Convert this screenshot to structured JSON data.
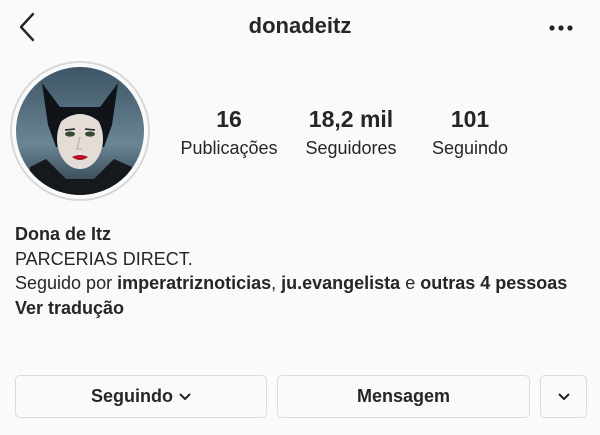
{
  "header": {
    "username": "donadeitz",
    "back_icon": "chevron-left-icon",
    "more_icon": "more-horizontal-icon"
  },
  "stats": {
    "posts": {
      "value": "16",
      "label": "Publicações"
    },
    "followers": {
      "value": "18,2 mil",
      "label": "Seguidores"
    },
    "following": {
      "value": "101",
      "label": "Seguindo"
    }
  },
  "bio": {
    "name": "Dona de Itz",
    "line1": "PARCERIAS DIRECT.",
    "followed_by_prefix": "Seguido por ",
    "follower1": "imperatriznoticias",
    "separator": ", ",
    "follower2": "ju.evangelista",
    "connector": " e ",
    "others": "outras 4 pessoas",
    "translate": "Ver tradução"
  },
  "actions": {
    "following_label": "Seguindo",
    "message_label": "Mensagem"
  },
  "colors": {
    "background": "#fafafa",
    "text": "#262626",
    "border": "#dbdbdb"
  }
}
